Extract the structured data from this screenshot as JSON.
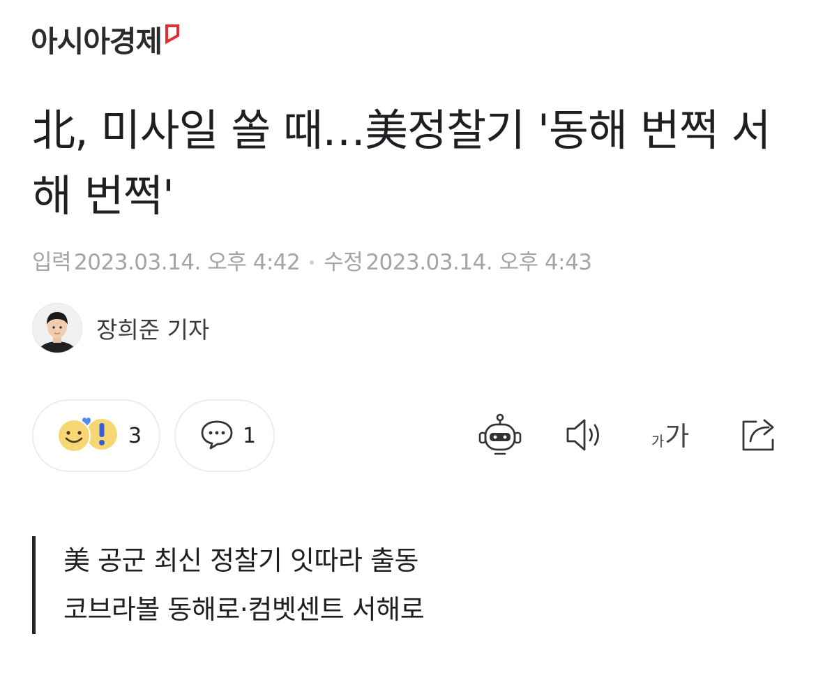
{
  "header": {
    "logo_text": "아시아경제",
    "logo_mark_color": "#e62e2e"
  },
  "article": {
    "title": "北, 미사일 쏠 때…美정찰기 '동해 번쩍 서해 번쩍'",
    "published_label": "입력",
    "published": "2023.03.14. 오후 4:42",
    "modified_label": "수정",
    "modified": "2023.03.14. 오후 4:43"
  },
  "author": {
    "name": "장희준 기자"
  },
  "actions": {
    "reaction_count": "3",
    "comment_count": "1",
    "icons": [
      "reaction-emoji-icon",
      "comment-bubble-icon",
      "robot-summary-icon",
      "speaker-icon",
      "font-size-icon",
      "share-icon"
    ],
    "font_size_small": "가",
    "font_size_big": "가"
  },
  "summary": {
    "lines": [
      "美 공군 최신 정찰기 잇따라 출동",
      "코브라볼 동해로·컴벳센트 서해로"
    ]
  }
}
